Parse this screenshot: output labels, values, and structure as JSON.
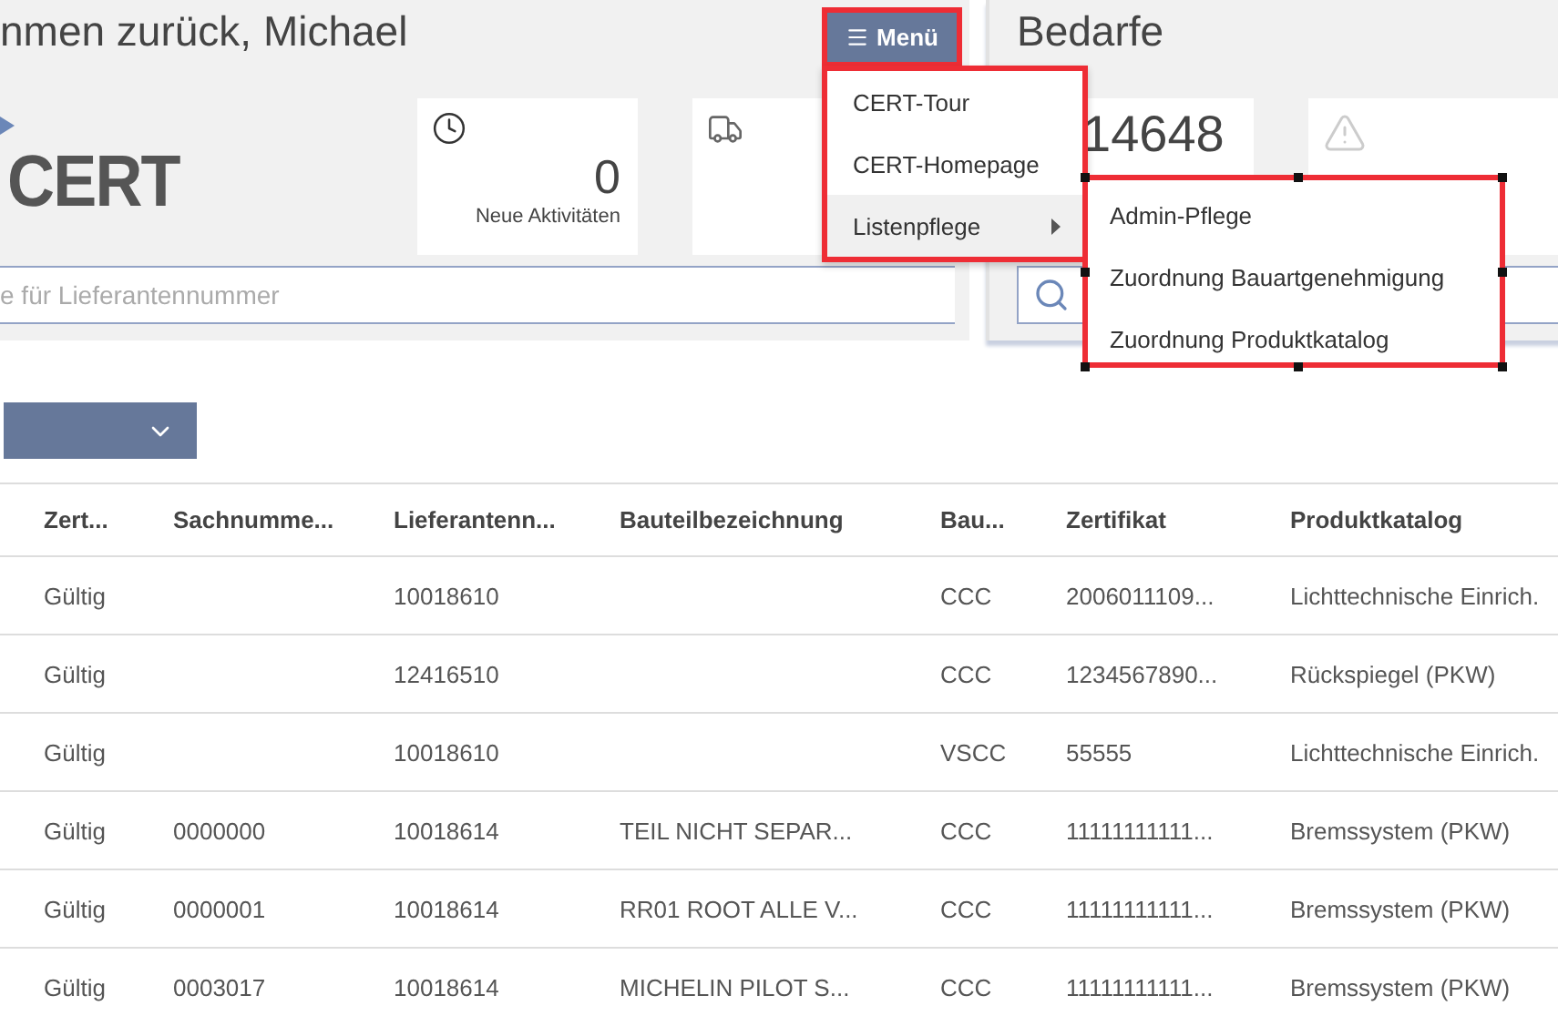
{
  "greeting": "nmen zurück, Michael",
  "menu_button": {
    "label": "Menü",
    "open": true
  },
  "menu": {
    "items": [
      {
        "label": "CERT-Tour",
        "selected": false,
        "has_submenu": false
      },
      {
        "label": "CERT-Homepage",
        "selected": false,
        "has_submenu": false
      },
      {
        "label": "Listenpflege",
        "selected": true,
        "has_submenu": true
      }
    ]
  },
  "submenu": {
    "items": [
      {
        "label": "Admin-Pflege"
      },
      {
        "label": "Zuordnung Bauartgenehmigung"
      },
      {
        "label": "Zuordnung Produktkatalog"
      }
    ]
  },
  "logo": "CERT",
  "tiles": [
    {
      "kind": "clock",
      "value": "0",
      "label": "Neue Aktivitäten"
    },
    {
      "kind": "truck"
    }
  ],
  "search": {
    "placeholder": "e für Lieferantennummer"
  },
  "right_panel": {
    "title": "Bedarfe",
    "tiles": [
      {
        "kind": "count",
        "value": "14648"
      },
      {
        "kind": "warning"
      }
    ]
  },
  "table": {
    "columns": [
      "Zert...",
      "Sachnumme...",
      "Lieferantenn...",
      "Bauteilbezeichnung",
      "Bau...",
      "Zertifikat",
      "Produktkatalog"
    ],
    "rows": [
      [
        "Gültig",
        "",
        "10018610",
        "",
        "CCC",
        "2006011109...",
        "Lichttechnische Einrich."
      ],
      [
        "Gültig",
        "",
        "12416510",
        "",
        "CCC",
        "1234567890...",
        "Rückspiegel (PKW)"
      ],
      [
        "Gültig",
        "",
        "10018610",
        "",
        "VSCC",
        "55555",
        "Lichttechnische Einrich."
      ],
      [
        "Gültig",
        "0000000",
        "10018614",
        "TEIL NICHT SEPAR...",
        "CCC",
        "11111111111...",
        "Bremssystem (PKW)"
      ],
      [
        "Gültig",
        "0000001",
        "10018614",
        "RR01 ROOT ALLE V...",
        "CCC",
        "11111111111...",
        "Bremssystem (PKW)"
      ],
      [
        "Gültig",
        "0003017",
        "10018614",
        "MICHELIN PILOT S...",
        "CCC",
        "11111111111...",
        "Bremssystem (PKW)"
      ]
    ]
  }
}
